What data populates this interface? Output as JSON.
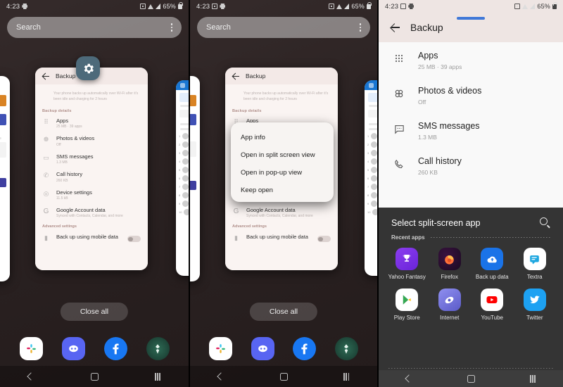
{
  "status_bar": {
    "time": "4:23",
    "battery": "65%",
    "icons": [
      "screenshot-icon",
      "print-icon",
      "sim-icon",
      "wifi-icon",
      "signal-icon",
      "lock-icon"
    ]
  },
  "recents": {
    "search_placeholder": "Search",
    "close_all_label": "Close all",
    "overflow_icon": "kebab-menu-icon",
    "gear_badge_icon": "settings-gear-icon"
  },
  "backup_card": {
    "header_title": "Backup",
    "back_icon": "arrow-back-icon",
    "description": "Your phone backs up automatically over Wi-Fi after it's been idle and charging for 2 hours",
    "section_label": "Backup details",
    "advanced_label": "Advanced settings",
    "items": [
      {
        "icon": "apps-grid-icon",
        "title": "Apps",
        "subtitle": "25 MB · 39 apps"
      },
      {
        "icon": "photos-icon",
        "title": "Photos & videos",
        "subtitle": "Off"
      },
      {
        "icon": "sms-icon",
        "title": "SMS messages",
        "subtitle": "1.3 MB"
      },
      {
        "icon": "call-history-icon",
        "title": "Call history",
        "subtitle": "260 KB"
      },
      {
        "icon": "device-settings-icon",
        "title": "Device settings",
        "subtitle": "11.5 kB"
      },
      {
        "icon": "google-icon",
        "title": "Google Account data",
        "subtitle": "Synced with Contacts, Calendar, and more"
      }
    ],
    "advanced_item": {
      "icon": "mobile-data-icon",
      "title": "Back up using mobile data",
      "toggle_state": "off"
    }
  },
  "popup_menu": {
    "items": [
      {
        "label": "App info"
      },
      {
        "label": "Open in split screen view"
      },
      {
        "label": "Open in pop-up view"
      },
      {
        "label": "Keep open"
      }
    ]
  },
  "split_view": {
    "header_title": "Backup",
    "back_icon": "arrow-back-icon",
    "drag_handle_icon": "drag-handle-icon",
    "items": [
      {
        "icon": "apps-grid-icon",
        "title": "Apps",
        "subtitle": "25 MB · 39 apps"
      },
      {
        "icon": "photos-icon",
        "title": "Photos & videos",
        "subtitle": "Off"
      },
      {
        "icon": "sms-icon",
        "title": "SMS messages",
        "subtitle": "1.3 MB"
      },
      {
        "icon": "call-history-icon",
        "title": "Call history",
        "subtitle": "260 KB"
      }
    ]
  },
  "app_picker": {
    "title": "Select split-screen app",
    "search_icon": "search-icon",
    "recent_label": "Recent apps",
    "apps": [
      {
        "label": "Yahoo Fantasy",
        "icon": "trophy-icon",
        "color": "#7b2ff7"
      },
      {
        "label": "Firefox",
        "icon": "firefox-icon",
        "color": "#2b1233"
      },
      {
        "label": "Back up data",
        "icon": "cloud-icon",
        "color": "#1a73e8"
      },
      {
        "label": "Textra",
        "icon": "message-icon",
        "color": "#ffffff"
      },
      {
        "label": "Play Store",
        "icon": "play-icon",
        "color": "#ffffff"
      },
      {
        "label": "Internet",
        "icon": "browser-icon",
        "color": "#6b6bd6"
      },
      {
        "label": "YouTube",
        "icon": "youtube-icon",
        "color": "#ffffff"
      },
      {
        "label": "Twitter",
        "icon": "twitter-icon",
        "color": "#1da1f2"
      }
    ]
  },
  "dock": {
    "apps": [
      {
        "label": "Slack",
        "icon": "slack-icon",
        "color": "#ffffff"
      },
      {
        "label": "Discord",
        "icon": "discord-icon",
        "color": "#5865f2"
      },
      {
        "label": "Facebook",
        "icon": "facebook-icon",
        "color": "#1877f2"
      },
      {
        "label": "Destiny",
        "icon": "destiny-icon",
        "color": "#1d3b33"
      }
    ]
  },
  "nav_bar": {
    "back_icon": "nav-back-icon",
    "home_icon": "nav-home-icon",
    "recents_icon": "nav-recents-icon"
  }
}
